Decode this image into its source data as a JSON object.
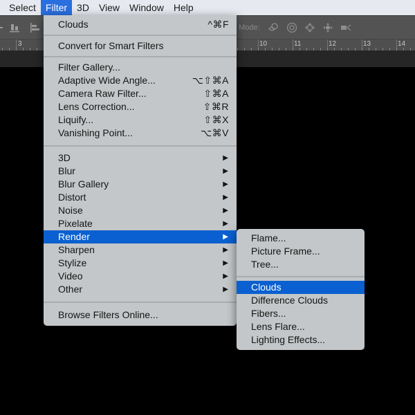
{
  "menubar": {
    "items": [
      {
        "label": "Select"
      },
      {
        "label": "Filter",
        "active": true
      },
      {
        "label": "3D"
      },
      {
        "label": "View"
      },
      {
        "label": "Window"
      },
      {
        "label": "Help"
      }
    ]
  },
  "options_bar": {
    "mode_label": "Mode:",
    "icons": [
      "orbit-3d-icon",
      "roll-3d-icon",
      "pan-3d-icon",
      "slide-3d-icon",
      "scale-3d-video-icon"
    ]
  },
  "ruler": {
    "labels": [
      "3",
      "10",
      "11",
      "12",
      "13",
      "14"
    ]
  },
  "filter_menu": {
    "group1": [
      {
        "label": "Clouds",
        "shortcut": "^⌘F"
      }
    ],
    "group2": [
      {
        "label": "Convert for Smart Filters"
      }
    ],
    "group3": [
      {
        "label": "Filter Gallery..."
      },
      {
        "label": "Adaptive Wide Angle...",
        "shortcut": "⌥⇧⌘A"
      },
      {
        "label": "Camera Raw Filter...",
        "shortcut": "⇧⌘A"
      },
      {
        "label": "Lens Correction...",
        "shortcut": "⇧⌘R"
      },
      {
        "label": "Liquify...",
        "shortcut": "⇧⌘X"
      },
      {
        "label": "Vanishing Point...",
        "shortcut": "⌥⌘V"
      }
    ],
    "group4": [
      {
        "label": "3D"
      },
      {
        "label": "Blur"
      },
      {
        "label": "Blur Gallery"
      },
      {
        "label": "Distort"
      },
      {
        "label": "Noise"
      },
      {
        "label": "Pixelate"
      },
      {
        "label": "Render",
        "highlighted": true
      },
      {
        "label": "Sharpen"
      },
      {
        "label": "Stylize"
      },
      {
        "label": "Video"
      },
      {
        "label": "Other"
      }
    ],
    "group5": [
      {
        "label": "Browse Filters Online..."
      }
    ]
  },
  "render_submenu": {
    "group1": [
      {
        "label": "Flame..."
      },
      {
        "label": "Picture Frame..."
      },
      {
        "label": "Tree..."
      }
    ],
    "group2": [
      {
        "label": "Clouds",
        "highlighted": true
      },
      {
        "label": "Difference Clouds"
      },
      {
        "label": "Fibers..."
      },
      {
        "label": "Lens Flare..."
      },
      {
        "label": "Lighting Effects..."
      }
    ]
  },
  "submenu_arrow": "▶",
  "colors": {
    "highlight": "#0a60d0",
    "menu_bg": "#c4c7c9",
    "menubar_bg": "#e6eaf0"
  }
}
